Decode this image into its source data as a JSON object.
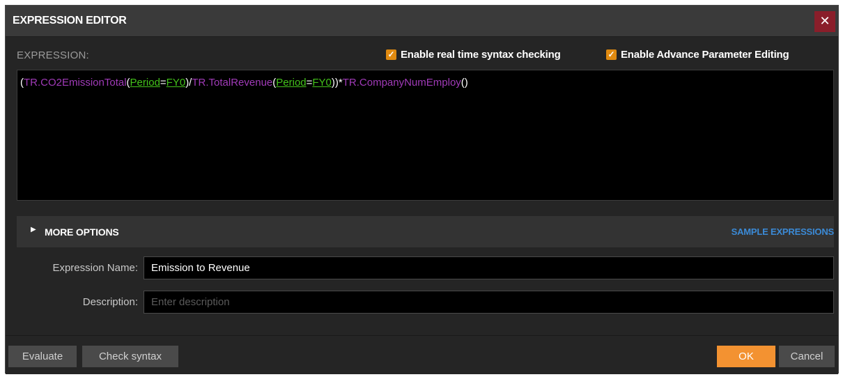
{
  "dialog": {
    "title": "EXPRESSION EDITOR",
    "close_icon": "✕"
  },
  "expression": {
    "label": "EXPRESSION:",
    "options": {
      "realtime_syntax": {
        "label": "Enable real time syntax checking",
        "checked": true
      },
      "advance_param": {
        "label": "Enable Advance Parameter Editing",
        "checked": true
      }
    },
    "tokens": {
      "t1": "(",
      "t2": "TR.CO2EmissionTotal",
      "t3": "(",
      "t4": "Period",
      "t5": "=",
      "t6": "FY0",
      "t7": ")/",
      "t8": "TR.TotalRevenue",
      "t9": "(",
      "t10": "Period",
      "t11": "=",
      "t12": "FY0",
      "t13": "))*",
      "t14": "TR.CompanyNumEmploy",
      "t15": "()"
    }
  },
  "more_options": {
    "label": "MORE OPTIONS",
    "sample_link": "SAMPLE EXPRESSIONS"
  },
  "fields": {
    "name": {
      "label": "Expression Name:",
      "value": "Emission to Revenue"
    },
    "description": {
      "label": "Description:",
      "placeholder": "Enter description"
    }
  },
  "footer": {
    "evaluate": "Evaluate",
    "check_syntax": "Check syntax",
    "ok": "OK",
    "cancel": "Cancel"
  },
  "colors": {
    "accent": "#f39231",
    "function": "#a03ab8",
    "parameter": "#43c21a",
    "link": "#3b8ad6",
    "close": "#8a1e2a"
  }
}
